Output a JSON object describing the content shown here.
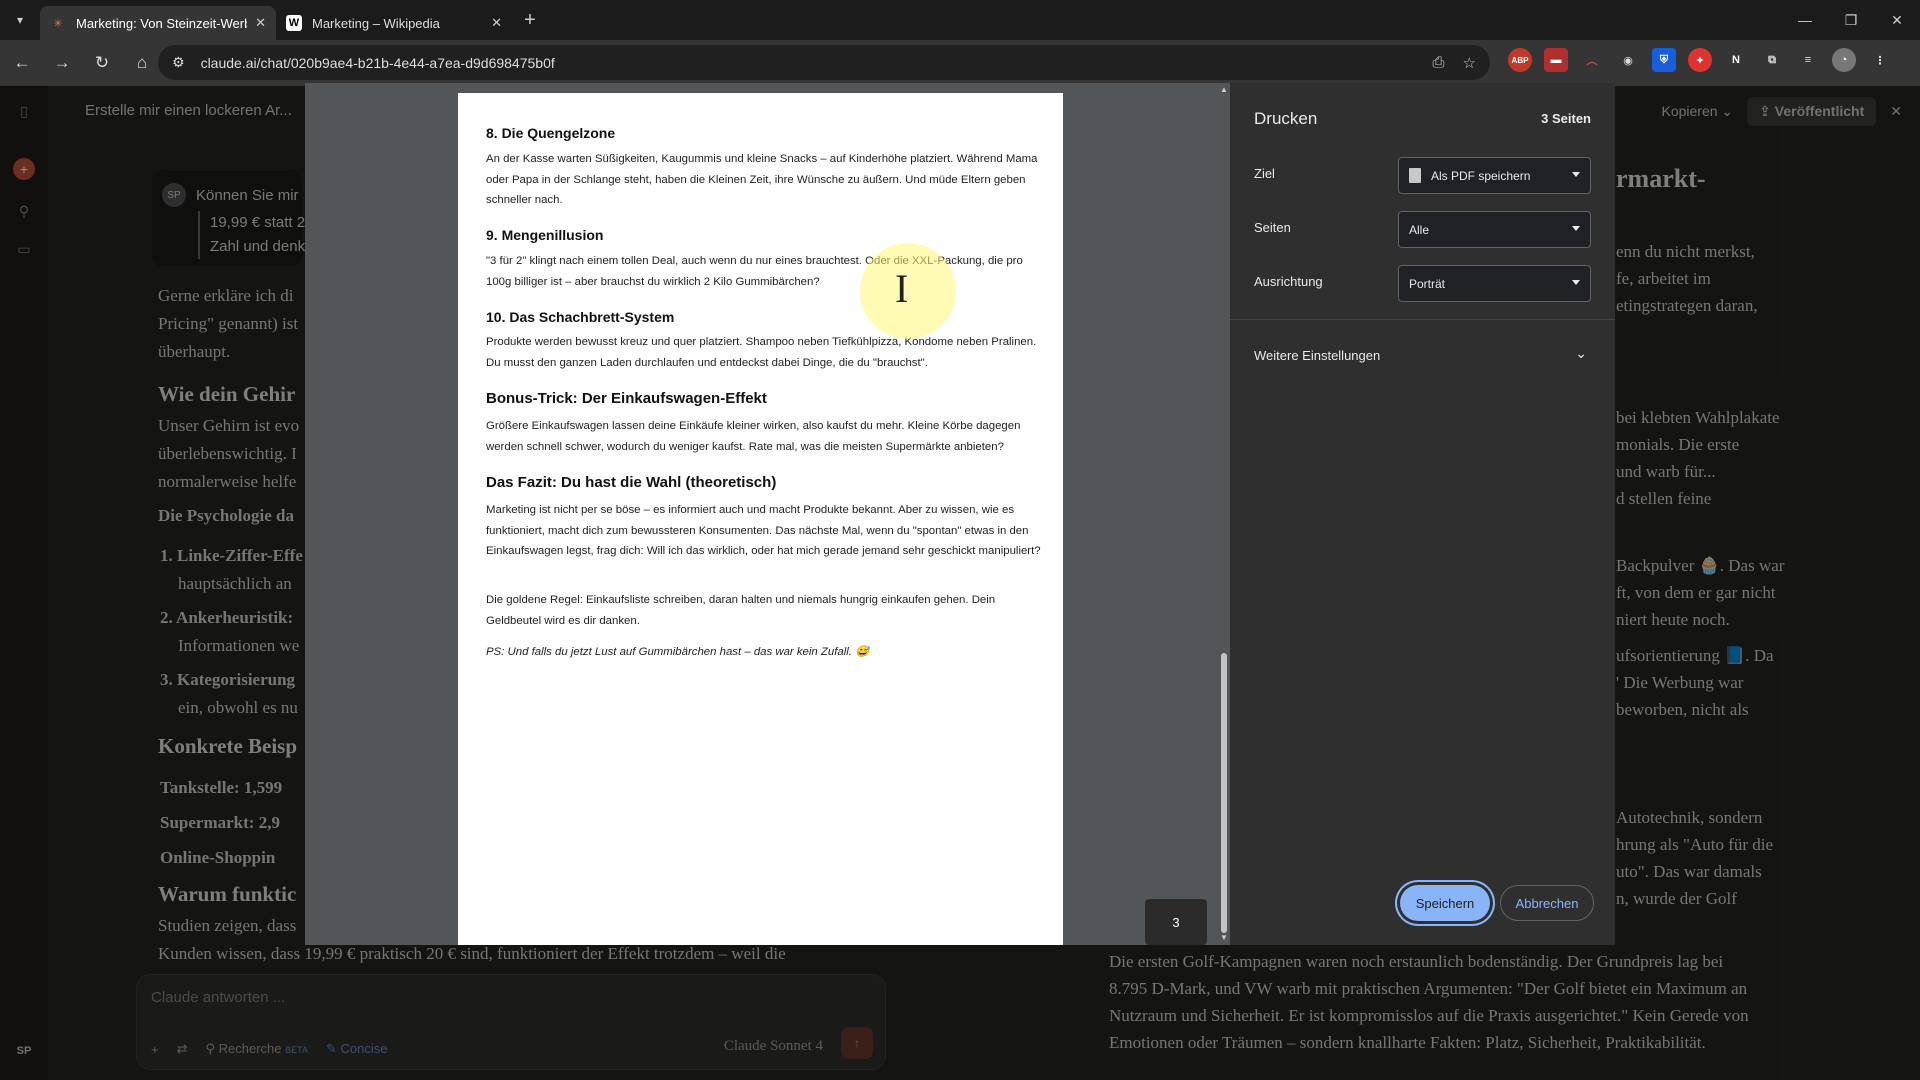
{
  "browser": {
    "tabs": [
      {
        "title": "Marketing: Von Steinzeit-Werbung",
        "favicon": "claude-icon",
        "active": true
      },
      {
        "title": "Marketing – Wikipedia",
        "favicon": "W",
        "active": false
      }
    ],
    "url": "claude.ai/chat/020b9ae4-b21b-4e44-a7ea-d9d698475b0f",
    "extensions": [
      "ABP",
      "",
      "",
      "",
      "",
      "",
      "N"
    ]
  },
  "background": {
    "chat_title": "Erstelle mir einen lockeren Ar...",
    "user_initials": "SP",
    "user_msg": "Können Sie mir",
    "quote_line1": "19,99 € statt 2",
    "quote_line2": "Zahl und denk",
    "para1": [
      "Gerne erkläre ich di",
      "Pricing\" genannt) ist",
      "überhaupt."
    ],
    "heading1": "Wie dein Gehir",
    "para2": [
      "Unser Gehirn ist evo",
      "überlebenswichtig. I",
      "normalerweise helfe"
    ],
    "psych": "Die Psychologie da",
    "list": [
      "1. Linke-Ziffer-Effe",
      "hauptsächlich an",
      "2. Ankerheuristik:",
      "Informationen we",
      "3. Kategorisierung",
      "ein, obwohl es nu"
    ],
    "heading2": "Konkrete Beisp",
    "bullets": [
      "Tankstelle: 1,599",
      "Supermarkt: 2,9",
      "Online-Shoppin"
    ],
    "heading3": "Warum funktic",
    "bottom_lines": [
      "Studien zeigen, dass",
      "Kunden wissen, dass 19,99 € praktisch 20 € sind, funktioniert der Effekt trotzdem – weil die"
    ],
    "input_placeholder": "Claude antworten ...",
    "tool_research": "Recherche",
    "tool_beta": "BETA",
    "tool_concise": "Concise",
    "model": "Claude Sonnet 4",
    "artifact_copy": "Kopieren",
    "artifact_publish": "Veröffentlicht",
    "artifact_heading": "rmarkt-",
    "artifact_lines": [
      "enn du nicht merkst,",
      "fe, arbeitet im",
      "etingstrategen daran,",
      "bei klebten Wahlplakate",
      "monials. Die erste",
      "und warb für...",
      "d stellen feine",
      "Backpulver 🧁. Das war",
      "ft, von dem er gar nicht",
      "niert heute noch.",
      "ufsorientierung 📘. Da",
      "' Die Werbung war",
      "beworben, nicht als",
      "Autotechnik, sondern",
      "hrung als \"Auto für die",
      "uto\". Das war damals",
      "n, wurde der Golf"
    ],
    "artifact_bottom": [
      "Die ersten Golf-Kampagnen waren noch erstaunlich bodenständig. Der Grundpreis lag bei",
      "8.795 D-Mark, und VW warb mit praktischen Argumenten: \"Der Golf bietet ein Maximum an",
      "Nutzraum und Sicherheit. Er ist kompromisslos auf die Praxis ausgerichtet.\" Kein Gerede von",
      "Emotionen oder Träumen – sondern knallharte Fakten: Platz, Sicherheit, Praktikabilität."
    ]
  },
  "preview": {
    "h_quengel": "8. Die Quengelzone",
    "p_quengel": "An der Kasse warten Süßigkeiten, Kaugummis und kleine Snacks – auf Kinderhöhe platziert. Während Mama oder Papa in der Schlange steht, haben die Kleinen Zeit, ihre Wünsche zu äußern. Und müde Eltern geben schneller nach.",
    "h_menge": "9. Mengenillusion",
    "p_menge": "\"3 für 2\" klingt nach einem tollen Deal, auch wenn du nur eines brauchtest. Oder die XXL-Packung, die pro 100g billiger ist – aber brauchst du wirklich 2 Kilo Gummibärchen?",
    "h_schach": "10. Das Schachbrett-System",
    "p_schach": "Produkte werden bewusst kreuz und quer platziert. Shampoo neben Tiefkühlpizza, Kondome neben Pralinen. Du musst den ganzen Laden durchlaufen und entdeckst dabei Dinge, die du \"brauchst\".",
    "h_bonus": "Bonus-Trick: Der Einkaufswagen-Effekt",
    "p_bonus": "Größere Einkaufswagen lassen deine Einkäufe kleiner wirken, also kaufst du mehr. Kleine Körbe dagegen werden schnell schwer, wodurch du weniger kaufst. Rate mal, was die meisten Supermärkte anbieten?",
    "h_fazit": "Das Fazit: Du hast die Wahl (theoretisch)",
    "p_fazit1": "Marketing ist nicht per se böse – es informiert auch und macht Produkte bekannt. Aber zu wissen, wie es funktioniert, macht dich zum bewussteren Konsumenten. Das nächste Mal, wenn du \"spontan\" etwas in den Einkaufswagen legst, frag dich: Will ich das wirklich, oder hat mich gerade jemand sehr geschickt manipuliert?",
    "p_fazit2": "Die goldene Regel: Einkaufsliste schreiben, daran halten und niemals hungrig einkaufen gehen. Dein Geldbeutel wird es dir danken.",
    "p_ps": "PS: Und falls du jetzt Lust auf Gummibärchen hast – das war kein Zufall. 😅",
    "page_number": "3"
  },
  "print_dialog": {
    "title": "Drucken",
    "page_count": "3 Seiten",
    "destination_label": "Ziel",
    "destination_value": "Als PDF speichern",
    "pages_label": "Seiten",
    "pages_value": "Alle",
    "orientation_label": "Ausrichtung",
    "orientation_value": "Porträt",
    "more_settings": "Weitere Einstellungen",
    "save_label": "Speichern",
    "cancel_label": "Abbrechen",
    "accent": "#8ab4f8"
  }
}
